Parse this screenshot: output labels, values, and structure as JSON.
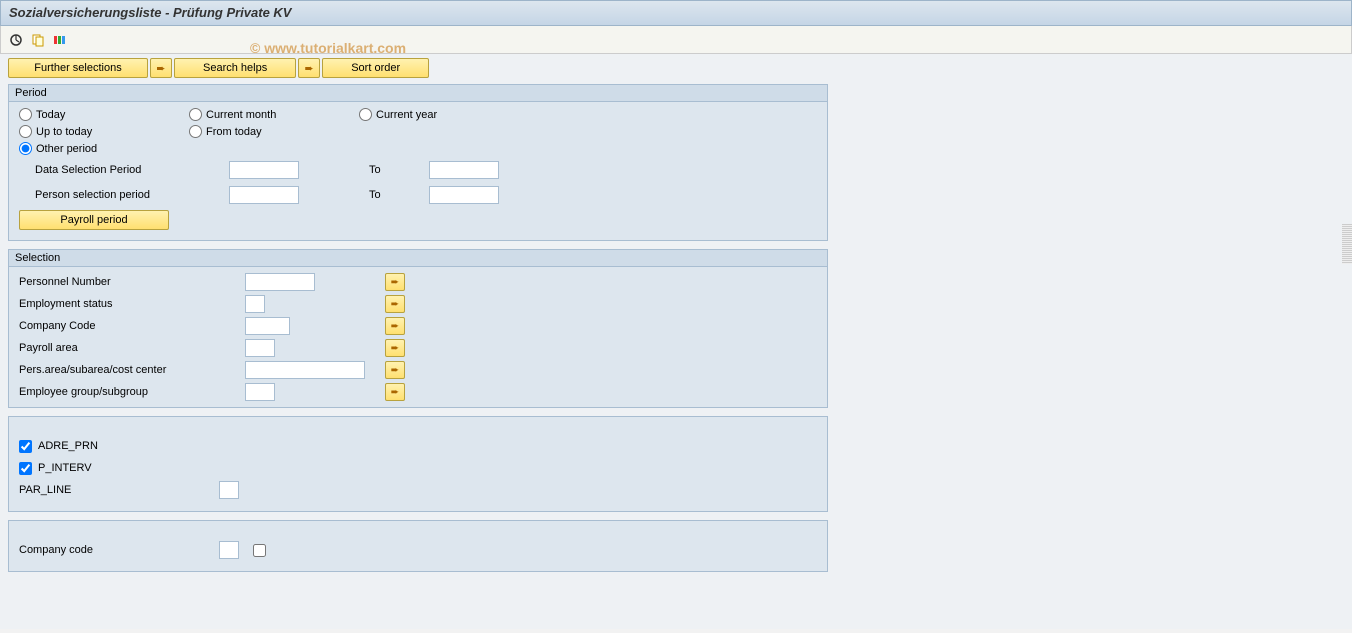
{
  "title": "Sozialversicherungsliste - Prüfung Private KV",
  "watermark": "© www.tutorialkart.com",
  "buttons": {
    "further_selections": "Further selections",
    "search_helps": "Search helps",
    "sort_order": "Sort order",
    "payroll_period": "Payroll period"
  },
  "period": {
    "title": "Period",
    "today": "Today",
    "current_month": "Current month",
    "current_year": "Current year",
    "up_to_today": "Up to today",
    "from_today": "From today",
    "other_period": "Other period",
    "data_selection_period": "Data Selection Period",
    "person_selection_period": "Person selection period",
    "to": "To",
    "selected": "other_period"
  },
  "selection": {
    "title": "Selection",
    "personnel_number": "Personnel Number",
    "employment_status": "Employment status",
    "company_code": "Company Code",
    "payroll_area": "Payroll area",
    "pers_area": "Pers.area/subarea/cost center",
    "employee_group": "Employee group/subgroup"
  },
  "params": {
    "adre_prn": "ADRE_PRN",
    "p_interv": "P_INTERV",
    "par_line": "PAR_LINE",
    "adre_prn_checked": true,
    "p_interv_checked": true
  },
  "company": {
    "label": "Company code"
  },
  "arrow_glyph": "➨"
}
